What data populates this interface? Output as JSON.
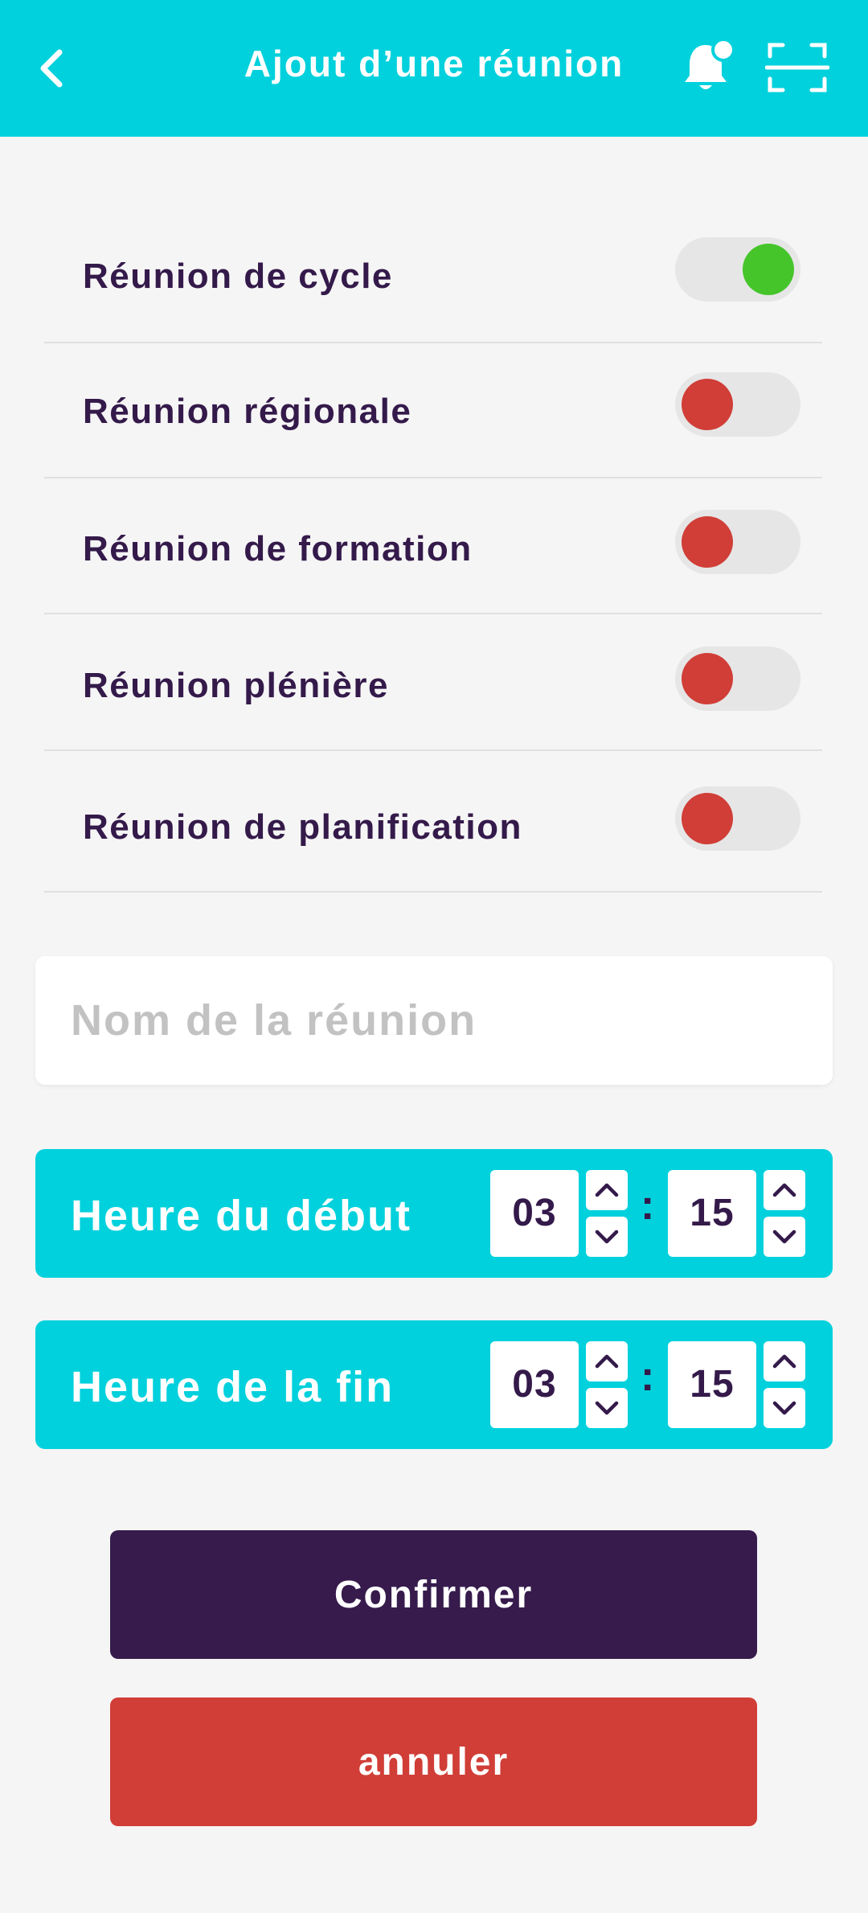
{
  "header": {
    "title": "Ajout d’une réunion",
    "back_icon": "chevron-left-icon",
    "bell_icon": "bell-notification-icon",
    "scan_icon": "scan-icon",
    "background": "#00d1dc"
  },
  "meeting_types": [
    {
      "label": "Réunion de cycle",
      "enabled": true
    },
    {
      "label": "Réunion régionale",
      "enabled": false
    },
    {
      "label": "Réunion de formation",
      "enabled": false
    },
    {
      "label": "Réunion plénière",
      "enabled": false
    },
    {
      "label": "Réunion de planification",
      "enabled": false
    }
  ],
  "toggle_colors": {
    "on": "#45c52a",
    "off": "#d03e37",
    "track": "#e6e6e6"
  },
  "name_field": {
    "placeholder": "Nom de la réunion",
    "value": ""
  },
  "start_time": {
    "label": "Heure du début",
    "hours": "03",
    "separator": ":",
    "minutes": "15"
  },
  "end_time": {
    "label": "Heure de la fin",
    "hours": "03",
    "separator": ":",
    "minutes": "15"
  },
  "buttons": {
    "confirm_label": "Confirmer",
    "cancel_label": "annuler",
    "confirm_color": "#361b4c",
    "cancel_color": "#d03e37"
  }
}
